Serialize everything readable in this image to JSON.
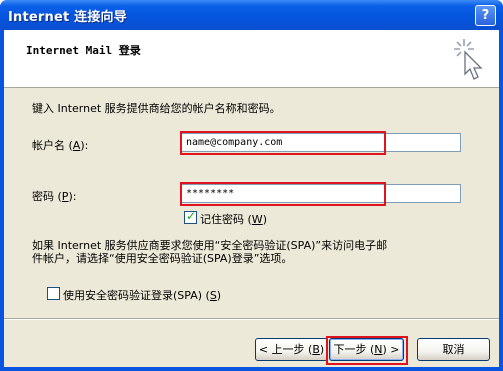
{
  "window": {
    "title": "Internet 连接向导",
    "help_glyph": "?"
  },
  "header": {
    "title": "Internet Mail 登录"
  },
  "form": {
    "intro": "键入 Internet 服务提供商给您的帐户名称和密码。",
    "account_label_prefix": "帐户名 (",
    "account_label_key": "A",
    "account_label_suffix": "):",
    "account_value": "name@company.com",
    "password_label_prefix": "密码 (",
    "password_label_key": "P",
    "password_label_suffix": "):",
    "password_value": "********",
    "remember_label_prefix": "记住密码 (",
    "remember_label_key": "W",
    "remember_label_suffix": ")",
    "remember_checked": true,
    "spa_note_line1": "如果 Internet 服务供应商要求您使用“安全密码验证(SPA)”来访问电子邮",
    "spa_note_line2": "件帐户，请选择“使用安全密码验证(SPA)登录”选项。",
    "spa_label_prefix": "使用安全密码验证登录(SPA) (",
    "spa_label_key": "S",
    "spa_label_suffix": ")",
    "spa_checked": false
  },
  "buttons": {
    "back_prefix": "< 上一步 (",
    "back_key": "B",
    "back_suffix": ")",
    "next_prefix": "下一步 (",
    "next_key": "N",
    "next_suffix": ") >",
    "cancel": "取消"
  },
  "colors": {
    "highlight_box": "#e0141e",
    "titlebar": "#0554dd",
    "dialog_bg": "#ece9d8"
  }
}
